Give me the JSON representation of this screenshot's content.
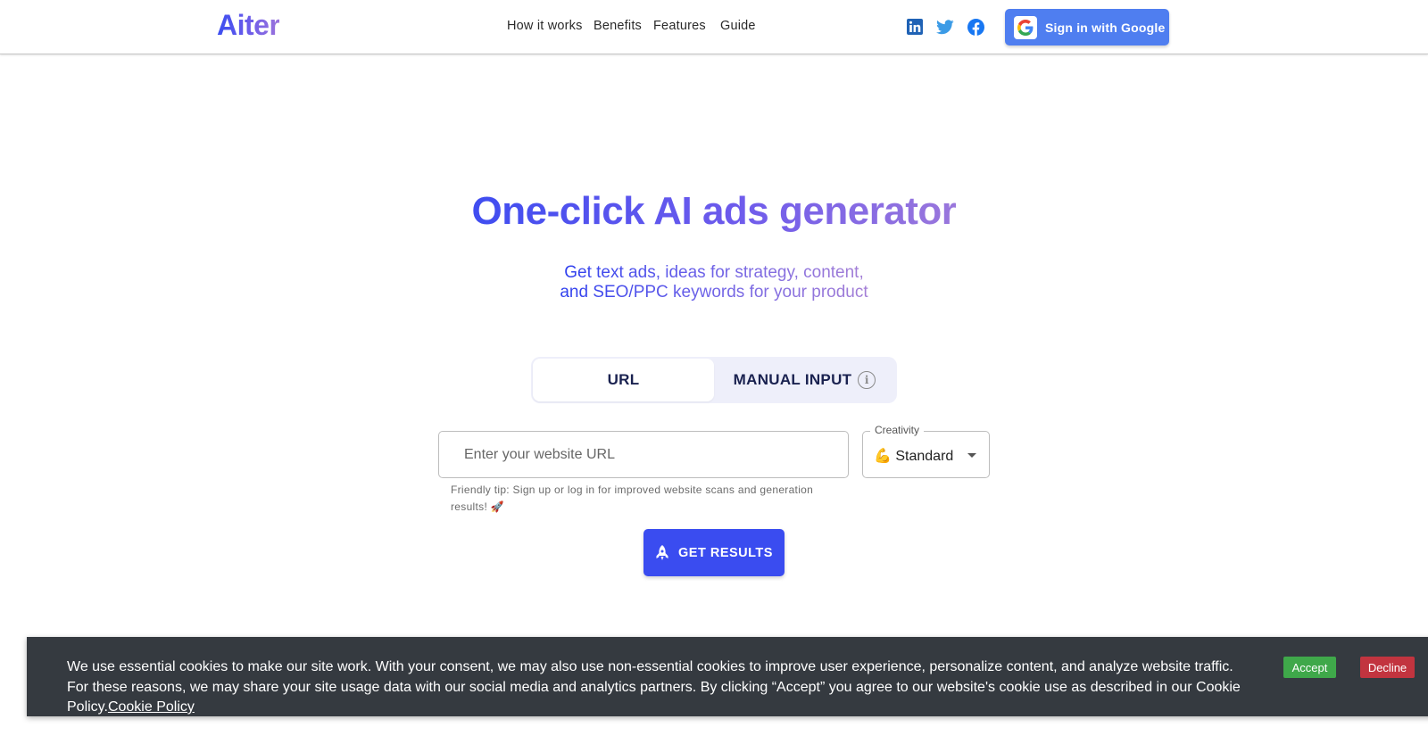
{
  "header": {
    "logo": "Aiter",
    "nav": [
      "How it works",
      "Benefits",
      "Features",
      "Guide"
    ],
    "social_icons": [
      "linkedin-icon",
      "twitter-icon",
      "facebook-icon"
    ],
    "signin_label": "Sign in with Google"
  },
  "hero": {
    "title": "One-click AI ads generator",
    "subtitle_line1": "Get text ads, ideas for strategy, content,",
    "subtitle_line2": "and SEO/PPC keywords for your product"
  },
  "tabs": {
    "url": "URL",
    "manual": "MANUAL INPUT",
    "active": "URL"
  },
  "form": {
    "url_placeholder": "Enter your website URL",
    "url_value": "",
    "tip": "Friendly tip: Sign up or log in for improved website scans and generation results! 🚀",
    "creativity_label": "Creativity",
    "creativity_value": "💪 Standard",
    "submit_label": "GET RESULTS"
  },
  "cookie": {
    "text": "We use essential cookies to make our site work. With your consent, we may also use non-essential cookies to improve user experience, personalize content, and analyze website traffic. For these reasons, we may share your site usage data with our social media and analytics partners. By clicking “Accept” you agree to our website's cookie use as described in our Cookie Policy.",
    "link": "Cookie Policy",
    "accept": "Accept",
    "decline": "Decline"
  },
  "colors": {
    "brand_blue": "#3a4cf0",
    "brand_purple": "#9b73dc",
    "google_button": "#4f7ef0",
    "accept_green": "#3fa84a",
    "decline_red": "#c2343f",
    "banner_bg": "#353a40"
  }
}
